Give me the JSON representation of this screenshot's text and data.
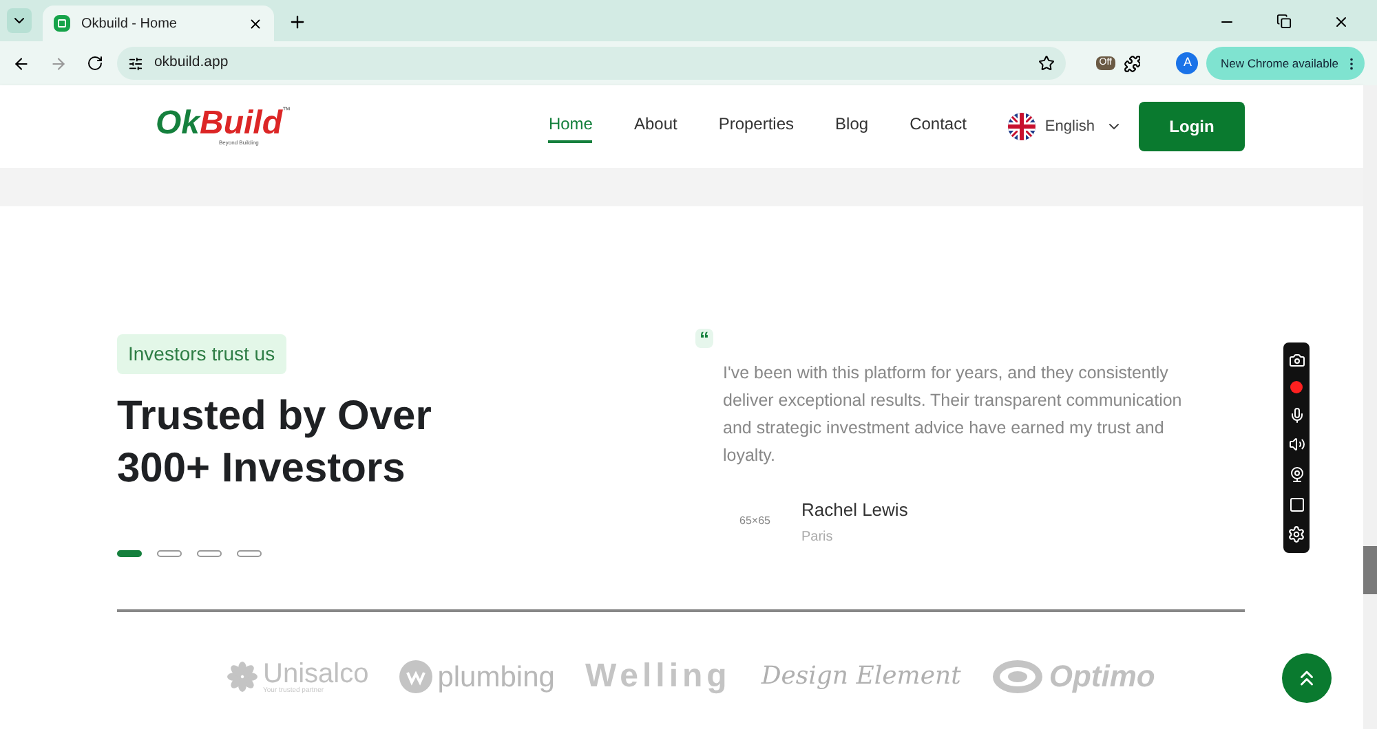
{
  "browser": {
    "tab_title": "Okbuild - Home",
    "url": "okbuild.app",
    "update_button": "New Chrome available",
    "profile_initial": "A",
    "extension_badge": "Off"
  },
  "header": {
    "logo": {
      "ok": "Ok",
      "build": "Build",
      "tm": "™",
      "tagline": "Beyond Building"
    },
    "nav": [
      {
        "label": "Home",
        "selected": true
      },
      {
        "label": "About",
        "selected": false
      },
      {
        "label": "Properties",
        "selected": false
      },
      {
        "label": "Blog",
        "selected": false
      },
      {
        "label": "Contact",
        "selected": false
      }
    ],
    "language": "English",
    "login": "Login"
  },
  "testimonials": {
    "badge": "Investors trust us",
    "heading": "Trusted by Over 300+ Investors",
    "quote_mark": "“",
    "quote": "I've been with this platform for years, and they consistently deliver exceptional results. Their transparent communication and strategic investment advice have earned my trust and loyalty.",
    "avatar_placeholder": "65×65",
    "author": "Rachel Lewis",
    "location": "Paris",
    "dots": [
      {
        "selected": true
      },
      {
        "selected": false
      },
      {
        "selected": false
      },
      {
        "selected": false
      }
    ]
  },
  "partners": [
    {
      "kind": "flower",
      "name": "Unisalco",
      "tagline": "Your trusted partner"
    },
    {
      "kind": "circle",
      "name": "plumbing"
    },
    {
      "kind": "wide",
      "name": "Welling"
    },
    {
      "kind": "script",
      "name": "Design Element"
    },
    {
      "kind": "eye",
      "name": "Optimo"
    }
  ]
}
